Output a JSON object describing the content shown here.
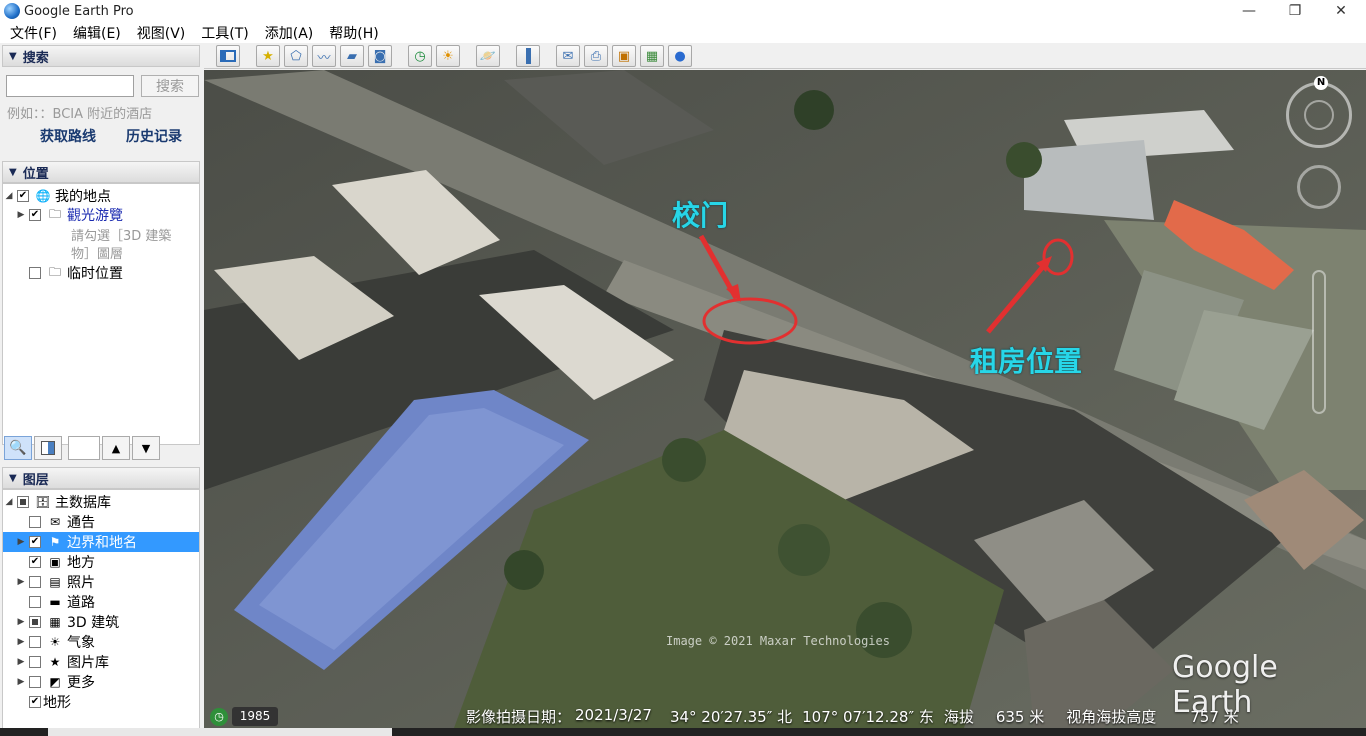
{
  "window": {
    "title": "Google Earth Pro",
    "minimize": "—",
    "maximize": "❐",
    "close": "✕"
  },
  "menu": [
    "文件(F)",
    "编辑(E)",
    "视图(V)",
    "工具(T)",
    "添加(A)",
    "帮助(H)"
  ],
  "search": {
    "header": "搜索",
    "input_value": "",
    "button": "搜索",
    "hint": "例如：：BCIA 附近的酒店",
    "get_directions": "获取路线",
    "history": "历史记录"
  },
  "places": {
    "header": "位置",
    "my_places": "我的地点",
    "sightseeing": "觀光游覽",
    "sightseeing_hint_1": "請勾選［3D 建築",
    "sightseeing_hint_2": "物］圖層",
    "temporary": "临时位置"
  },
  "layers": {
    "header": "图层",
    "items": [
      {
        "label": "主数据库",
        "checked": "partial",
        "expandable": true,
        "icon": "database-icon"
      },
      {
        "label": "通告",
        "checked": "false",
        "expandable": false,
        "icon": "mail-icon"
      },
      {
        "label": "边界和地名",
        "checked": "true",
        "expandable": true,
        "icon": "flag-icon",
        "selected": true
      },
      {
        "label": "地方",
        "checked": "true",
        "expandable": false,
        "icon": "place-icon"
      },
      {
        "label": "照片",
        "checked": "false",
        "expandable": true,
        "icon": "photo-icon"
      },
      {
        "label": "道路",
        "checked": "false",
        "expandable": false,
        "icon": "road-icon"
      },
      {
        "label": "3D 建筑",
        "checked": "partial",
        "expandable": true,
        "icon": "building-icon"
      },
      {
        "label": "气象",
        "checked": "false",
        "expandable": true,
        "icon": "sun-icon"
      },
      {
        "label": "图片库",
        "checked": "false",
        "expandable": true,
        "icon": "star-icon"
      },
      {
        "label": "更多",
        "checked": "false",
        "expandable": true,
        "icon": "more-icon"
      },
      {
        "label": "地形",
        "checked": "true",
        "expandable": false,
        "icon": "terrain-icon"
      }
    ]
  },
  "map": {
    "annotation_gate": "校门",
    "annotation_rental": "租房位置",
    "copyright": "Image © 2021 Maxar Technologies",
    "logo": "Google Earth",
    "compass_n": "N",
    "year": "1985",
    "status": {
      "capture_date_label": "影像拍摄日期：",
      "capture_date": "2021/3/27",
      "lat": "34° 20′27.35″ 北",
      "lon": "107° 07′12.28″ 东",
      "elev_label": "海拔",
      "elev": "635 米",
      "eye_label": "视角海拔高度",
      "eye": "757 米"
    },
    "colors": {
      "annotation": "#27d6e8",
      "highlight": "#e23030",
      "selection": "#3399ff"
    }
  }
}
